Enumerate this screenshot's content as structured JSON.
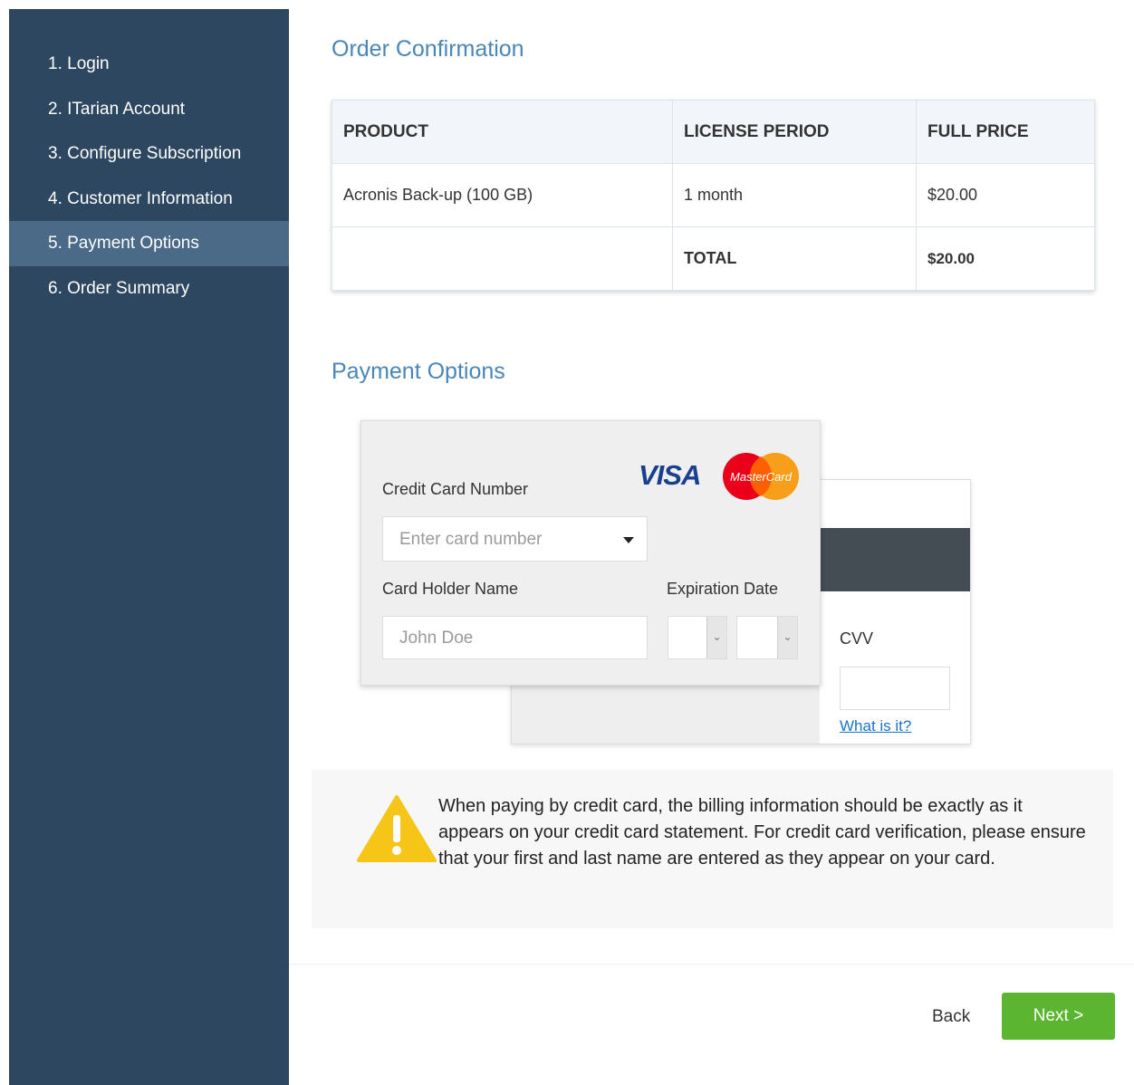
{
  "sidebar": {
    "items": [
      {
        "label": "1. Login"
      },
      {
        "label": "2. ITarian Account"
      },
      {
        "label": "3. Configure Subscription"
      },
      {
        "label": "4. Customer Information"
      },
      {
        "label": "5. Payment Options",
        "active": true
      },
      {
        "label": "6. Order Summary"
      }
    ]
  },
  "order": {
    "title": "Order Confirmation",
    "headers": [
      "PRODUCT",
      "LICENSE PERIOD",
      "FULL PRICE"
    ],
    "rows": [
      [
        "Acronis Back-up (100 GB)",
        "1 month",
        "$20.00"
      ]
    ],
    "total_label": "TOTAL",
    "total_value": "$20.00"
  },
  "payment": {
    "title": "Payment Options",
    "card_number_label": "Credit Card Number",
    "card_number_placeholder": "Enter card number",
    "holder_label": "Card Holder Name",
    "holder_placeholder": "John Doe",
    "expiration_label": "Expiration Date",
    "cvv_label": "CVV",
    "what_link": "What is it?",
    "visa_logo": "VISA",
    "mastercard_logo": "MasterCard"
  },
  "warning": {
    "text": "When paying by credit card, the billing information should be exactly as it appears on your credit card statement. For credit card verification, please ensure that your first and last name are entered as they appear on your card."
  },
  "footer": {
    "back_label": "Back",
    "next_label": "Next >"
  },
  "colors": {
    "sidebar_bg": "#2c475f",
    "sidebar_active": "#4a6a87",
    "title_blue": "#4a86b8",
    "next_green": "#5cb531"
  }
}
